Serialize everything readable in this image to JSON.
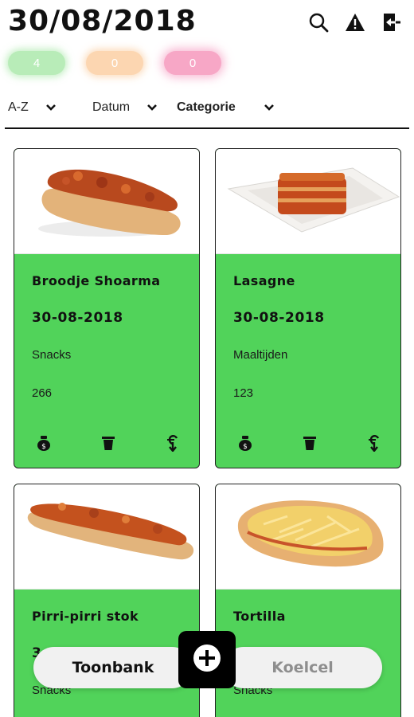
{
  "header": {
    "title": "30/08/2018",
    "icons": [
      "search-icon",
      "warning-icon",
      "logout-icon"
    ]
  },
  "badges": [
    {
      "value": "4",
      "color": "#b8ecb8"
    },
    {
      "value": "0",
      "color": "#fcd6b1"
    },
    {
      "value": "0",
      "color": "#f7a7c6"
    }
  ],
  "filters": {
    "sort": "A-Z",
    "date": "Datum",
    "category": "Categorie"
  },
  "cards": [
    {
      "name": "Broodje Shoarma",
      "date": "30-08-2018",
      "category": "Snacks",
      "number": "266",
      "image": "shoarma-bread-image"
    },
    {
      "name": "Lasagne",
      "date": "30-08-2018",
      "category": "Maaltijden",
      "number": "123",
      "image": "lasagne-plate-image"
    },
    {
      "name": "Pirri-pirri stok",
      "date": "3",
      "category": "Snacks",
      "number": "",
      "image": "pirri-stick-image"
    },
    {
      "name": "Tortilla",
      "date": "",
      "category": "Snacks",
      "number": "",
      "image": "tortilla-image"
    }
  ],
  "card_actions": [
    "money-bag-icon",
    "trash-icon",
    "euro-arrow-icon"
  ],
  "bottom": {
    "left_label": "Toonbank",
    "right_label": "Koelcel",
    "add_icon": "plus-icon"
  },
  "colors": {
    "card_green": "#51d35a",
    "accent": "#000000"
  }
}
